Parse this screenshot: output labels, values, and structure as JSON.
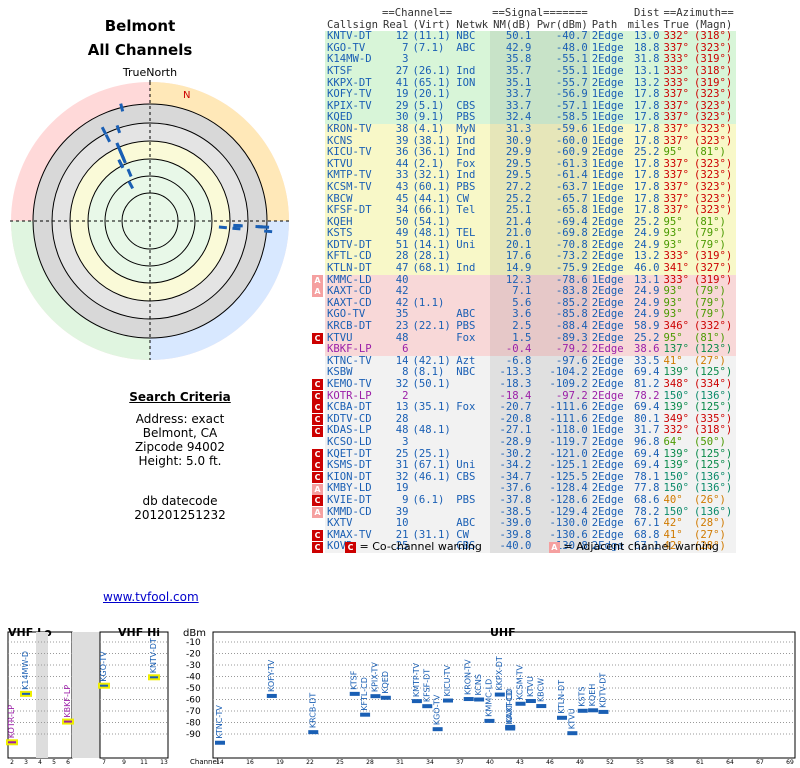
{
  "location": {
    "title": "Belmont",
    "subtitle": "All Channels"
  },
  "radar": {
    "north_label": "TrueNorth",
    "n_marker": "N"
  },
  "search": {
    "header": "Search Criteria",
    "lines": [
      "Address: exact",
      "Belmont, CA",
      "Zipcode 94002",
      "Height: 5.0 ft."
    ],
    "db_label": "db datecode",
    "db_value": "201201251232"
  },
  "link_text": "www.tvfool.com",
  "table": {
    "group_headers": {
      "channel": "==Channel==",
      "signal": "==Signal=======",
      "dist": "Dist",
      "azimuth": "==Azimuth=="
    },
    "headers": [
      "Callsign",
      "Real",
      "(Virt)",
      "Netwk",
      "NM(dB)",
      "Pwr(dBm)",
      "Path",
      "miles",
      "True",
      "(Magn)"
    ],
    "rows": [
      {
        "call": "KNTV-DT",
        "real": "12",
        "virt": "(11.1)",
        "net": "NBC",
        "nm": "50.1",
        "pwr": "-40.7",
        "path": "2Edge",
        "mi": "13.0",
        "tru": "332°",
        "mag": "(318°)",
        "color": "#1a5fb4",
        "bg": "g",
        "warn": ""
      },
      {
        "call": "KGO-TV",
        "real": "7",
        "virt": "(7.1)",
        "net": "ABC",
        "nm": "42.9",
        "pwr": "-48.0",
        "path": "1Edge",
        "mi": "18.8",
        "tru": "337°",
        "mag": "(323°)",
        "color": "#1a5fb4",
        "bg": "g",
        "warn": ""
      },
      {
        "call": "K14MW-D",
        "real": "3",
        "virt": "",
        "net": "",
        "nm": "35.8",
        "pwr": "-55.1",
        "path": "2Edge",
        "mi": "31.8",
        "tru": "333°",
        "mag": "(319°)",
        "color": "#1a5fb4",
        "bg": "g",
        "warn": ""
      },
      {
        "call": "KTSF",
        "real": "27",
        "virt": "(26.1)",
        "net": "Ind",
        "nm": "35.7",
        "pwr": "-55.1",
        "path": "1Edge",
        "mi": "13.1",
        "tru": "333°",
        "mag": "(318°)",
        "color": "#1a5fb4",
        "bg": "g",
        "warn": ""
      },
      {
        "call": "KKPX-DT",
        "real": "41",
        "virt": "(65.1)",
        "net": "ION",
        "nm": "35.1",
        "pwr": "-55.7",
        "path": "2Edge",
        "mi": "13.2",
        "tru": "333°",
        "mag": "(319°)",
        "color": "#1a5fb4",
        "bg": "g",
        "warn": ""
      },
      {
        "call": "KOFY-TV",
        "real": "19",
        "virt": "(20.1)",
        "net": "",
        "nm": "33.7",
        "pwr": "-56.9",
        "path": "1Edge",
        "mi": "17.8",
        "tru": "337°",
        "mag": "(323°)",
        "color": "#1a5fb4",
        "bg": "g",
        "warn": ""
      },
      {
        "call": "KPIX-TV",
        "real": "29",
        "virt": "(5.1)",
        "net": "CBS",
        "nm": "33.7",
        "pwr": "-57.1",
        "path": "1Edge",
        "mi": "17.8",
        "tru": "337°",
        "mag": "(323°)",
        "color": "#1a5fb4",
        "bg": "g",
        "warn": ""
      },
      {
        "call": "KQED",
        "real": "30",
        "virt": "(9.1)",
        "net": "PBS",
        "nm": "32.4",
        "pwr": "-58.5",
        "path": "1Edge",
        "mi": "17.8",
        "tru": "337°",
        "mag": "(323°)",
        "color": "#1a5fb4",
        "bg": "g",
        "warn": ""
      },
      {
        "call": "KRON-TV",
        "real": "38",
        "virt": "(4.1)",
        "net": "MyN",
        "nm": "31.3",
        "pwr": "-59.6",
        "path": "1Edge",
        "mi": "17.8",
        "tru": "337°",
        "mag": "(323°)",
        "color": "#1a5fb4",
        "bg": "y",
        "warn": ""
      },
      {
        "call": "KCNS",
        "real": "39",
        "virt": "(38.1)",
        "net": "Ind",
        "nm": "30.9",
        "pwr": "-60.0",
        "path": "1Edge",
        "mi": "17.8",
        "tru": "337°",
        "mag": "(323°)",
        "color": "#1a5fb4",
        "bg": "y",
        "warn": ""
      },
      {
        "call": "KICU-TV",
        "real": "36",
        "virt": "(36.1)",
        "net": "Ind",
        "nm": "29.9",
        "pwr": "-60.9",
        "path": "2Edge",
        "mi": "25.2",
        "tru": "95°",
        "mag": "(81°)",
        "color": "#1a5fb4",
        "bg": "y",
        "warn": ""
      },
      {
        "call": "KTVU",
        "real": "44",
        "virt": "(2.1)",
        "net": "Fox",
        "nm": "29.5",
        "pwr": "-61.3",
        "path": "1Edge",
        "mi": "17.8",
        "tru": "337°",
        "mag": "(323°)",
        "color": "#1a5fb4",
        "bg": "y",
        "warn": ""
      },
      {
        "call": "KMTP-TV",
        "real": "33",
        "virt": "(32.1)",
        "net": "Ind",
        "nm": "29.5",
        "pwr": "-61.4",
        "path": "1Edge",
        "mi": "17.8",
        "tru": "337°",
        "mag": "(323°)",
        "color": "#1a5fb4",
        "bg": "y",
        "warn": ""
      },
      {
        "call": "KCSM-TV",
        "real": "43",
        "virt": "(60.1)",
        "net": "PBS",
        "nm": "27.2",
        "pwr": "-63.7",
        "path": "1Edge",
        "mi": "17.8",
        "tru": "337°",
        "mag": "(323°)",
        "color": "#1a5fb4",
        "bg": "y",
        "warn": ""
      },
      {
        "call": "KBCW",
        "real": "45",
        "virt": "(44.1)",
        "net": "CW",
        "nm": "25.2",
        "pwr": "-65.7",
        "path": "1Edge",
        "mi": "17.8",
        "tru": "337°",
        "mag": "(323°)",
        "color": "#1a5fb4",
        "bg": "y",
        "warn": ""
      },
      {
        "call": "KFSF-DT",
        "real": "34",
        "virt": "(66.1)",
        "net": "Tel",
        "nm": "25.1",
        "pwr": "-65.8",
        "path": "1Edge",
        "mi": "17.8",
        "tru": "337°",
        "mag": "(323°)",
        "color": "#1a5fb4",
        "bg": "y",
        "warn": ""
      },
      {
        "call": "KQEH",
        "real": "50",
        "virt": "(54.1)",
        "net": "",
        "nm": "21.4",
        "pwr": "-69.4",
        "path": "2Edge",
        "mi": "25.2",
        "tru": "95°",
        "mag": "(81°)",
        "color": "#1a5fb4",
        "bg": "y",
        "warn": ""
      },
      {
        "call": "KSTS",
        "real": "49",
        "virt": "(48.1)",
        "net": "TEL",
        "nm": "21.0",
        "pwr": "-69.8",
        "path": "2Edge",
        "mi": "24.9",
        "tru": "93°",
        "mag": "(79°)",
        "color": "#1a5fb4",
        "bg": "y",
        "warn": ""
      },
      {
        "call": "KDTV-DT",
        "real": "51",
        "virt": "(14.1)",
        "net": "Uni",
        "nm": "20.1",
        "pwr": "-70.8",
        "path": "2Edge",
        "mi": "24.9",
        "tru": "93°",
        "mag": "(79°)",
        "color": "#1a5fb4",
        "bg": "y",
        "warn": ""
      },
      {
        "call": "KFTL-CD",
        "real": "28",
        "virt": "(28.1)",
        "net": "",
        "nm": "17.6",
        "pwr": "-73.2",
        "path": "2Edge",
        "mi": "13.2",
        "tru": "333°",
        "mag": "(319°)",
        "color": "#1a5fb4",
        "bg": "y",
        "warn": ""
      },
      {
        "call": "KTLN-DT",
        "real": "47",
        "virt": "(68.1)",
        "net": "Ind",
        "nm": "14.9",
        "pwr": "-75.9",
        "path": "2Edge",
        "mi": "46.0",
        "tru": "341°",
        "mag": "(327°)",
        "color": "#1a5fb4",
        "bg": "y",
        "warn": ""
      },
      {
        "call": "KMMC-LD",
        "real": "40",
        "virt": "",
        "net": "",
        "nm": "12.3",
        "pwr": "-78.6",
        "path": "1Edge",
        "mi": "13.1",
        "tru": "333°",
        "mag": "(319°)",
        "color": "#1a5fb4",
        "bg": "p",
        "warn": "a"
      },
      {
        "call": "KAXT-CD",
        "real": "42",
        "virt": "",
        "net": "",
        "nm": "7.1",
        "pwr": "-83.8",
        "path": "2Edge",
        "mi": "24.9",
        "tru": "93°",
        "mag": "(79°)",
        "color": "#1a5fb4",
        "bg": "p",
        "warn": "a"
      },
      {
        "call": "KAXT-CD",
        "real": "42",
        "virt": "(1.1)",
        "net": "",
        "nm": "5.6",
        "pwr": "-85.2",
        "path": "2Edge",
        "mi": "24.9",
        "tru": "93°",
        "mag": "(79°)",
        "color": "#1a5fb4",
        "bg": "p",
        "warn": ""
      },
      {
        "call": "KGO-TV",
        "real": "35",
        "virt": "",
        "net": "ABC",
        "nm": "3.6",
        "pwr": "-85.8",
        "path": "2Edge",
        "mi": "24.9",
        "tru": "93°",
        "mag": "(79°)",
        "color": "#1a5fb4",
        "bg": "p",
        "warn": ""
      },
      {
        "call": "KRCB-DT",
        "real": "23",
        "virt": "(22.1)",
        "net": "PBS",
        "nm": "2.5",
        "pwr": "-88.4",
        "path": "2Edge",
        "mi": "58.9",
        "tru": "346°",
        "mag": "(332°)",
        "color": "#1a5fb4",
        "bg": "p",
        "warn": ""
      },
      {
        "call": "KTVU",
        "real": "48",
        "virt": "",
        "net": "Fox",
        "nm": "1.5",
        "pwr": "-89.3",
        "path": "2Edge",
        "mi": "25.2",
        "tru": "95°",
        "mag": "(81°)",
        "color": "#1a5fb4",
        "bg": "p",
        "warn": "c"
      },
      {
        "call": "KBKF-LP",
        "real": "6",
        "virt": "",
        "net": "",
        "nm": "-0.4",
        "pwr": "-79.2",
        "path": "2Edge",
        "mi": "38.6",
        "tru": "137°",
        "mag": "(123°)",
        "color": "#9b1fa8",
        "bg": "p",
        "warn": ""
      },
      {
        "call": "KTNC-TV",
        "real": "14",
        "virt": "(42.1)",
        "net": "Azt",
        "nm": "-6.8",
        "pwr": "-97.6",
        "path": "2Edge",
        "mi": "33.5",
        "tru": "41°",
        "mag": "(27°)",
        "color": "#1a5fb4",
        "bg": "w",
        "warn": ""
      },
      {
        "call": "KSBW",
        "real": "8",
        "virt": "(8.1)",
        "net": "NBC",
        "nm": "-13.3",
        "pwr": "-104.2",
        "path": "2Edge",
        "mi": "69.4",
        "tru": "139°",
        "mag": "(125°)",
        "color": "#1a5fb4",
        "bg": "w",
        "warn": ""
      },
      {
        "call": "KEMO-TV",
        "real": "32",
        "virt": "(50.1)",
        "net": "",
        "nm": "-18.3",
        "pwr": "-109.2",
        "path": "2Edge",
        "mi": "81.2",
        "tru": "348°",
        "mag": "(334°)",
        "color": "#1a5fb4",
        "bg": "w",
        "warn": "c"
      },
      {
        "call": "KOTR-LP",
        "real": "2",
        "virt": "",
        "net": "",
        "nm": "-18.4",
        "pwr": "-97.2",
        "path": "2Edge",
        "mi": "78.2",
        "tru": "150°",
        "mag": "(136°)",
        "color": "#9b1fa8",
        "bg": "w",
        "warn": "c"
      },
      {
        "call": "KCBA-DT",
        "real": "13",
        "virt": "(35.1)",
        "net": "Fox",
        "nm": "-20.7",
        "pwr": "-111.6",
        "path": "2Edge",
        "mi": "69.4",
        "tru": "139°",
        "mag": "(125°)",
        "color": "#1a5fb4",
        "bg": "w",
        "warn": "c"
      },
      {
        "call": "KDTV-CD",
        "real": "28",
        "virt": "",
        "net": "",
        "nm": "-20.8",
        "pwr": "-111.6",
        "path": "2Edge",
        "mi": "80.1",
        "tru": "349°",
        "mag": "(335°)",
        "color": "#1a5fb4",
        "bg": "w",
        "warn": "c"
      },
      {
        "call": "KDAS-LP",
        "real": "48",
        "virt": "(48.1)",
        "net": "",
        "nm": "-27.1",
        "pwr": "-118.0",
        "path": "1Edge",
        "mi": "31.7",
        "tru": "332°",
        "mag": "(318°)",
        "color": "#1a5fb4",
        "bg": "w",
        "warn": "c"
      },
      {
        "call": "KCSO-LD",
        "real": "3",
        "virt": "",
        "net": "",
        "nm": "-28.9",
        "pwr": "-119.7",
        "path": "2Edge",
        "mi": "96.8",
        "tru": "64°",
        "mag": "(50°)",
        "color": "#1a5fb4",
        "bg": "w",
        "warn": ""
      },
      {
        "call": "KQET-DT",
        "real": "25",
        "virt": "(25.1)",
        "net": "",
        "nm": "-30.2",
        "pwr": "-121.0",
        "path": "2Edge",
        "mi": "69.4",
        "tru": "139°",
        "mag": "(125°)",
        "color": "#1a5fb4",
        "bg": "w",
        "warn": "c"
      },
      {
        "call": "KSMS-DT",
        "real": "31",
        "virt": "(67.1)",
        "net": "Uni",
        "nm": "-34.2",
        "pwr": "-125.1",
        "path": "2Edge",
        "mi": "69.4",
        "tru": "139°",
        "mag": "(125°)",
        "color": "#1a5fb4",
        "bg": "w",
        "warn": "c"
      },
      {
        "call": "KION-DT",
        "real": "32",
        "virt": "(46.1)",
        "net": "CBS",
        "nm": "-34.7",
        "pwr": "-125.5",
        "path": "2Edge",
        "mi": "78.1",
        "tru": "150°",
        "mag": "(136°)",
        "color": "#1a5fb4",
        "bg": "w",
        "warn": "c"
      },
      {
        "call": "KMBY-LD",
        "real": "19",
        "virt": "",
        "net": "",
        "nm": "-37.6",
        "pwr": "-128.4",
        "path": "2Edge",
        "mi": "77.8",
        "tru": "150°",
        "mag": "(136°)",
        "color": "#1a5fb4",
        "bg": "w",
        "warn": "a"
      },
      {
        "call": "KVIE-DT",
        "real": "9",
        "virt": "(6.1)",
        "net": "PBS",
        "nm": "-37.8",
        "pwr": "-128.6",
        "path": "2Edge",
        "mi": "68.6",
        "tru": "40°",
        "mag": "(26°)",
        "color": "#1a5fb4",
        "bg": "w",
        "warn": "c"
      },
      {
        "call": "KMMD-CD",
        "real": "39",
        "virt": "",
        "net": "",
        "nm": "-38.5",
        "pwr": "-129.4",
        "path": "2Edge",
        "mi": "78.2",
        "tru": "150°",
        "mag": "(136°)",
        "color": "#1a5fb4",
        "bg": "w",
        "warn": "a"
      },
      {
        "call": "KXTV",
        "real": "10",
        "virt": "",
        "net": "ABC",
        "nm": "-39.0",
        "pwr": "-130.0",
        "path": "2Edge",
        "mi": "67.1",
        "tru": "42°",
        "mag": "(28°)",
        "color": "#1a5fb4",
        "bg": "w",
        "warn": ""
      },
      {
        "call": "KMAX-TV",
        "real": "21",
        "virt": "(31.1)",
        "net": "CW",
        "nm": "-39.8",
        "pwr": "-130.6",
        "path": "2Edge",
        "mi": "68.8",
        "tru": "41°",
        "mag": "(27°)",
        "color": "#1a5fb4",
        "bg": "w",
        "warn": "c"
      },
      {
        "call": "KOVR",
        "real": "25",
        "virt": "",
        "net": "CBS",
        "nm": "-40.0",
        "pwr": "-130.8",
        "path": "2Edge",
        "mi": "67.1",
        "tru": "42°",
        "mag": "(28°)",
        "color": "#1a5fb4",
        "bg": "w",
        "warn": "c"
      }
    ]
  },
  "legend": {
    "c_text": "= Co-channel warning",
    "a_text": "= Adjacent channel warning"
  },
  "spectrum": {
    "vhf_lo": "VHF Lo",
    "vhf_hi": "VHF Hi",
    "uhf": "UHF",
    "dbm": "dBm",
    "channel_label": "Channel",
    "dbm_ticks": [
      "-10",
      "-20",
      "-30",
      "-40",
      "-50",
      "-60",
      "-70",
      "-80",
      "-90"
    ],
    "vhflo_ticks": [
      "2",
      "3",
      "4",
      "5",
      "6"
    ],
    "vhfhi_ticks": [
      "7",
      "9",
      "11",
      "13"
    ],
    "uhf_ticks": [
      "14",
      "16",
      "19",
      "22",
      "25",
      "28",
      "31",
      "34",
      "37",
      "40",
      "43",
      "46",
      "49",
      "52",
      "55",
      "58",
      "61",
      "64",
      "67",
      "69"
    ]
  },
  "colors": {
    "green": "#d8f5d8",
    "yellow": "#f8f8c8",
    "pink": "#f8d8d8",
    "white": "#f2f2f2",
    "blue": "#1a5fb4",
    "purple": "#9b1fa8"
  }
}
